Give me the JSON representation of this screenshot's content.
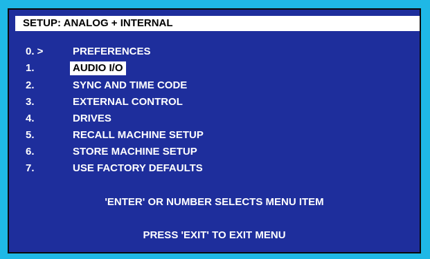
{
  "colors": {
    "outer_frame": "#1fb8e6",
    "screen_background": "#1e2e9c",
    "text": "#ffffff",
    "title_bar_background": "#ffffff",
    "title_text": "#000000",
    "selection_background": "#ffffff",
    "selection_text": "#000000"
  },
  "header": {
    "title": "SETUP: ANALOG + INTERNAL"
  },
  "menu": {
    "items": [
      {
        "number": "0. >",
        "label": "PREFERENCES",
        "selected": false
      },
      {
        "number": "1.",
        "label": "AUDIO I/O",
        "selected": true
      },
      {
        "number": "2.",
        "label": "SYNC AND TIME CODE",
        "selected": false
      },
      {
        "number": "3.",
        "label": "EXTERNAL CONTROL",
        "selected": false
      },
      {
        "number": "4.",
        "label": "DRIVES",
        "selected": false
      },
      {
        "number": "5.",
        "label": "RECALL MACHINE SETUP",
        "selected": false
      },
      {
        "number": "6.",
        "label": "STORE MACHINE SETUP",
        "selected": false
      },
      {
        "number": "7.",
        "label": "USE FACTORY DEFAULTS",
        "selected": false
      }
    ]
  },
  "footer": {
    "select_hint": "'ENTER' OR NUMBER SELECTS MENU ITEM",
    "exit_hint": "PRESS 'EXIT' TO EXIT MENU"
  }
}
